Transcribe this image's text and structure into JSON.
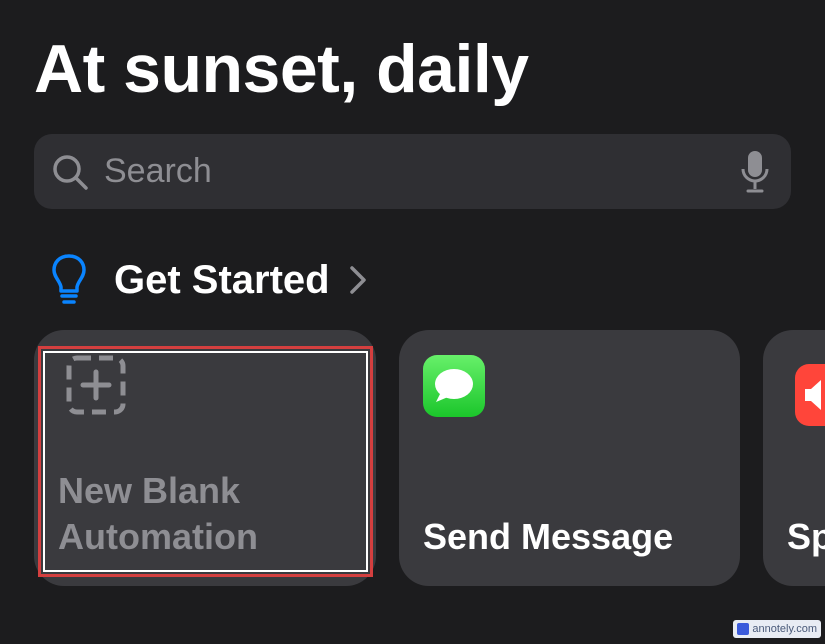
{
  "header": {
    "title": "At sunset, daily"
  },
  "search": {
    "placeholder": "Search",
    "value": ""
  },
  "section": {
    "label": "Get Started"
  },
  "cards": [
    {
      "label_line1": "New Blank",
      "label_line2": "Automation",
      "icon": "dashed-plus-icon"
    },
    {
      "label": "Send Message",
      "icon": "messages-icon",
      "icon_color": "#1bc62b"
    },
    {
      "label": "Sp",
      "icon": "speaker-icon",
      "icon_color": "#ff453a"
    }
  ],
  "watermark": {
    "text": "annotely.com"
  },
  "colors": {
    "background": "#1c1c1e",
    "card": "#3a3a3e",
    "accent_blue": "#0a84ff",
    "highlight_red": "#d43f3f"
  }
}
